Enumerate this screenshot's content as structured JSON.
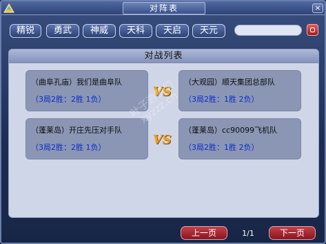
{
  "window": {
    "title": "对阵表",
    "close_label": "×"
  },
  "tabs": [
    {
      "label": "精锐"
    },
    {
      "label": "勇武"
    },
    {
      "label": "神威"
    },
    {
      "label": "天科"
    },
    {
      "label": "天启"
    },
    {
      "label": "天元"
    }
  ],
  "search": {
    "value": "",
    "placeholder": ""
  },
  "panel": {
    "title": "对战列表"
  },
  "matches": [
    {
      "left": {
        "name": "（曲阜孔庙）我们是曲阜队",
        "record": "（3局2胜：2胜 1负）"
      },
      "vs": "VS",
      "right": {
        "name": "（大观园）顺天集团总部队",
        "record": "（3局2胜：1胜 2负）"
      }
    },
    {
      "left": {
        "name": "（蓬莱岛）开庄先压对手队",
        "record": "（3局2胜：2胜 1负）"
      },
      "vs": "VS",
      "right": {
        "name": "（蓬莱岛）cc90099飞机队",
        "record": "（3局2胜：1胜 2负）"
      }
    }
  ],
  "watermark": {
    "line1": "叶子游梦幻",
    "line2": "xyzzz.cn"
  },
  "pager": {
    "prev_label": "上一页",
    "page": "1/1",
    "next_label": "下一页"
  }
}
